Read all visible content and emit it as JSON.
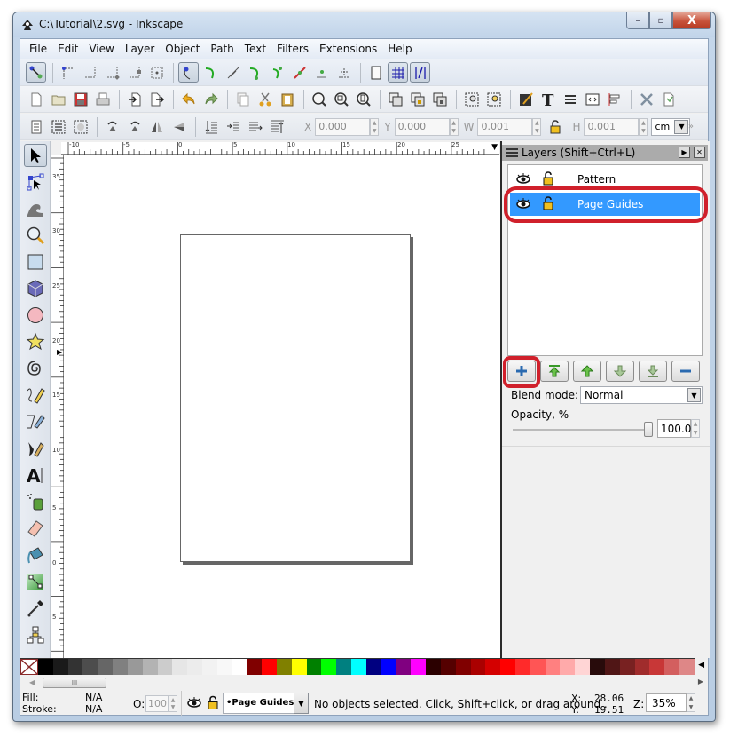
{
  "window": {
    "title": "C:\\Tutorial\\2.svg - Inkscape",
    "controls": {
      "minimize": "–",
      "maximize": "▫",
      "close": "X"
    }
  },
  "menu": [
    {
      "label": "File"
    },
    {
      "label": "Edit"
    },
    {
      "label": "View"
    },
    {
      "label": "Layer"
    },
    {
      "label": "Object"
    },
    {
      "label": "Path"
    },
    {
      "label": "Text"
    },
    {
      "label": "Filters"
    },
    {
      "label": "Extensions"
    },
    {
      "label": "Help"
    }
  ],
  "snap_toolbar": {
    "icons": [
      "snap-enable-icon",
      "snap-bbox-icon",
      "snap-bbox-edge-icon",
      "snap-bbox-corner-icon",
      "snap-bbox-midpoint-icon",
      "snap-bbox-center-icon",
      "snap-nodes-icon",
      "snap-paths-icon",
      "snap-intersections-icon",
      "snap-cusp-nodes-icon",
      "snap-smooth-nodes-icon",
      "snap-line-midpoints-icon",
      "snap-object-center-icon",
      "snap-rotation-center-icon",
      "snap-page-border-icon",
      "snap-grid-icon",
      "snap-guide-icon"
    ]
  },
  "command_toolbar": {
    "icons": [
      "new-document-icon",
      "open-icon",
      "save-icon",
      "print-icon",
      "import-icon",
      "export-icon",
      "undo-icon",
      "redo-icon",
      "copy-icon",
      "cut-icon",
      "paste-icon",
      "zoom-selection-icon",
      "zoom-drawing-icon",
      "zoom-page-icon",
      "duplicate-icon",
      "clone-icon",
      "unlink-clone-icon",
      "group-icon",
      "ungroup-icon",
      "fill-stroke-icon",
      "text-font-icon",
      "layers-icon",
      "xml-editor-icon",
      "align-distribute-icon",
      "preferences-icon",
      "document-properties-icon"
    ]
  },
  "select_toolbar": {
    "x_label": "X",
    "x_value": "0.000",
    "y_label": "Y",
    "y_value": "0.000",
    "w_label": "W",
    "w_value": "0.001",
    "h_label": "H",
    "h_value": "0.001",
    "unit": "cm",
    "overflow": "»"
  },
  "toolbox": {
    "tools": [
      "selector-tool-icon",
      "node-tool-icon",
      "tweak-tool-icon",
      "zoom-tool-icon",
      "rectangle-tool-icon",
      "3d-box-tool-icon",
      "ellipse-tool-icon",
      "star-tool-icon",
      "spiral-tool-icon",
      "pencil-tool-icon",
      "pen-tool-icon",
      "calligraphy-tool-icon",
      "text-tool-icon",
      "spray-tool-icon",
      "eraser-tool-icon",
      "paint-bucket-tool-icon",
      "gradient-tool-icon",
      "dropper-tool-icon",
      "connector-tool-icon"
    ],
    "active": "selector-tool-icon"
  },
  "rulers": {
    "horizontal": [
      "-10",
      "-5",
      "0",
      "5",
      "10",
      "15",
      "20",
      "25"
    ],
    "vertical": [
      "35",
      "30",
      "25",
      "20",
      "15",
      "10",
      "5",
      "0",
      "5"
    ]
  },
  "layers_panel": {
    "title": "Layers (Shift+Ctrl+L)",
    "layers": [
      {
        "name": "Pattern",
        "visible": true,
        "locked": false,
        "selected": false
      },
      {
        "name": "Page Guides",
        "visible": true,
        "locked": false,
        "selected": true
      }
    ],
    "buttons": [
      "add-layer",
      "raise-layer-to-top",
      "raise-layer",
      "lower-layer",
      "lower-layer-to-bottom",
      "delete-layer"
    ],
    "blend_label": "Blend mode:",
    "blend_value": "Normal",
    "opacity_label": "Opacity, %",
    "opacity_value": "100.0",
    "opacity_percent": 100,
    "highlight_color": "#d0202b",
    "selected_color": "#3399ff"
  },
  "palette": [
    "#000000",
    "#1a1a1a",
    "#333333",
    "#4d4d4d",
    "#666666",
    "#808080",
    "#999999",
    "#b3b3b3",
    "#cccccc",
    "#e6e6e6",
    "#ececec",
    "#f2f2f2",
    "#f8f8f8",
    "#ffffff",
    "#800000",
    "#ff0000",
    "#808000",
    "#ffff00",
    "#008000",
    "#00ff00",
    "#008080",
    "#00ffff",
    "#000080",
    "#0000ff",
    "#800080",
    "#ff00ff",
    "#2b0000",
    "#550000",
    "#800000",
    "#aa0000",
    "#d40000",
    "#ff0000",
    "#ff2a2a",
    "#ff5555",
    "#ff8080",
    "#ffaaaa",
    "#ffd5d5",
    "#280b0b",
    "#501616",
    "#782121",
    "#a02c2c",
    "#c83737",
    "#d35f5f",
    "#de8787"
  ],
  "statusbar": {
    "fill_label": "Fill:",
    "fill_value": "N/A",
    "stroke_label": "Stroke:",
    "stroke_value": "N/A",
    "opacity_label": "O:",
    "opacity_value": "100",
    "current_layer": "•Page Guides",
    "message": "No objects selected. Click, Shift+click, or drag around .",
    "x_label": "X:",
    "x_value": "28.06",
    "y_label": "Y:",
    "y_value": "19.51",
    "zoom_label": "Z:",
    "zoom_value": "35%"
  }
}
